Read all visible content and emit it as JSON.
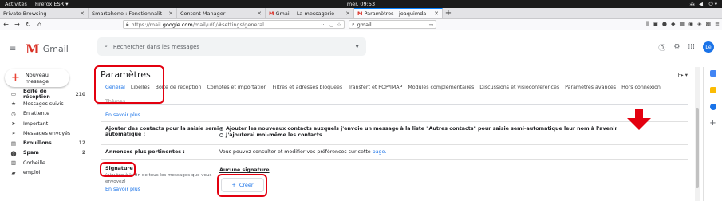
{
  "desktop": {
    "activities": "Activités",
    "app": "Firefox ESR ▾",
    "clock": "mer. 09:53",
    "tray": [
      "⁂",
      "◀)",
      "⏻ ▾"
    ]
  },
  "browser": {
    "tabs": [
      {
        "label": "Private Browsing",
        "active": false
      },
      {
        "label": "Smartphone : Fonctionnalit",
        "active": false
      },
      {
        "label": "Content Manager",
        "active": false
      },
      {
        "label": "Gmail – La messagerie",
        "active": false
      },
      {
        "label": "Paramètres - joaquimda",
        "active": true
      }
    ],
    "url_prefix": "https://mail.",
    "url_host": "google.com",
    "url_path": "/mail/u/0/#settings/general",
    "search_value": "gmail"
  },
  "gmail": {
    "logo_text": "Gmail",
    "search_placeholder": "Rechercher dans les messages",
    "avatar_initials": "Le",
    "compose_label": "Nouveau message",
    "nav": [
      {
        "icon": "inbox-icon",
        "glyph": "▭",
        "label": "Boîte de réception",
        "count": "210",
        "bold": true
      },
      {
        "icon": "star-icon",
        "glyph": "★",
        "label": "Messages suivis",
        "count": "",
        "bold": false
      },
      {
        "icon": "clock-icon",
        "glyph": "◷",
        "label": "En attente",
        "count": "",
        "bold": false
      },
      {
        "icon": "important-icon",
        "glyph": "➤",
        "label": "Important",
        "count": "",
        "bold": false
      },
      {
        "icon": "send-icon",
        "glyph": "➢",
        "label": "Messages envoyés",
        "count": "",
        "bold": false
      },
      {
        "icon": "draft-icon",
        "glyph": "▤",
        "label": "Brouillons",
        "count": "12",
        "bold": true
      },
      {
        "icon": "spam-icon",
        "glyph": "⓿",
        "label": "Spam",
        "count": "2",
        "bold": true
      },
      {
        "icon": "trash-icon",
        "glyph": "▥",
        "label": "Corbeille",
        "count": "",
        "bold": false
      },
      {
        "icon": "label-icon",
        "glyph": "▰",
        "label": "emploi",
        "count": "",
        "bold": false
      }
    ]
  },
  "settings": {
    "title": "Paramètres",
    "tabs": [
      "Général",
      "Libellés",
      "Boîte de réception",
      "Comptes et importation",
      "Filtres et adresses bloquées",
      "Transfert et POP/IMAP",
      "Modules complémentaires",
      "Discussions et visioconférences",
      "Paramètres avancés",
      "Hors connexion"
    ],
    "tabs_row2": "Thèmes",
    "learn_more": "En savoir plus",
    "contacts_label_1": "Ajouter des contacts pour la saisie semi-",
    "contacts_label_2": "automatique :",
    "contacts_opt1": "Ajouter les nouveaux contacts auxquels j'envoie un message à la liste \"Autres contacts\" pour saisie semi-automatique leur nom à l'avenir",
    "contacts_opt2": "J'ajouterai moi-même les contacts",
    "ads_label": "Annonces plus pertinentes :",
    "ads_text": "Vous pouvez consulter et modifier vos préférences sur cette",
    "ads_link": "page.",
    "signature_label": "Signature :",
    "signature_sub_1": "(ajoutée à la fin de tous les messages que vous",
    "signature_sub_2": "envoyez)",
    "no_signature": "Aucune signature",
    "create_label": "Créer"
  },
  "colors": {
    "annotation_red": "#e3000f",
    "gmail_red": "#d93025",
    "link_blue": "#1a73e8"
  }
}
